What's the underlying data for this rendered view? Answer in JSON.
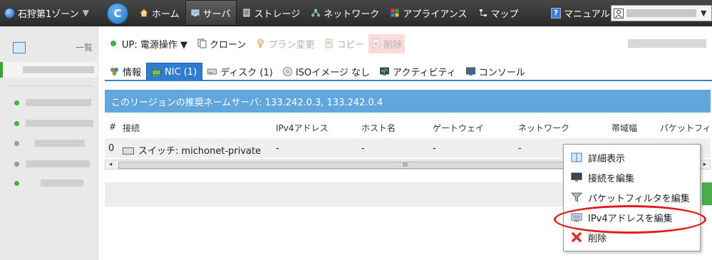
{
  "topbar": {
    "zone_label": "石狩第1ゾーン",
    "zone_caret": "▼",
    "refresh_glyph": "C",
    "nav": [
      {
        "label": "ホーム",
        "icon": "home-icon"
      },
      {
        "label": "サーバ",
        "icon": "monitor-icon",
        "active": true
      },
      {
        "label": "ストレージ",
        "icon": "storage-icon"
      },
      {
        "label": "ネットワーク",
        "icon": "network-icon"
      },
      {
        "label": "アプライアンス",
        "icon": "appliance-icon"
      },
      {
        "label": "マップ",
        "icon": "map-icon"
      }
    ],
    "manual_label": "マニュアル",
    "manual_glyph": "?",
    "user_caret": "▼"
  },
  "sidebar": {
    "list_label": "一覧"
  },
  "actions": {
    "power_label": "UP: 電源操作 ▼",
    "clone_label": "クローン",
    "plan_label": "プラン変更",
    "copy_label": "コピー",
    "delete_label": "削除"
  },
  "tabs": [
    {
      "label": "情報",
      "icon": "info-icon"
    },
    {
      "label": "NIC (1)",
      "icon": "nic-icon",
      "active": true
    },
    {
      "label": "ディスク (1)",
      "icon": "disk-icon"
    },
    {
      "label": "ISOイメージ なし",
      "icon": "cd-icon"
    },
    {
      "label": "アクティビティ",
      "icon": "activity-icon"
    },
    {
      "label": "コンソール",
      "icon": "console-icon"
    }
  ],
  "info_message": "このリージョンの推奨ネームサーバ: 133.242.0.3, 133.242.0.4",
  "table": {
    "headers": [
      "#",
      "接続",
      "IPv4アドレス",
      "ホスト名",
      "ゲートウェイ",
      "ネットワーク",
      "帯域幅",
      "パケットフィ"
    ],
    "rows": [
      [
        "0",
        "スイッチ: michonet-private",
        "-",
        "-",
        "-",
        "-"
      ]
    ],
    "scroll_left": "◂",
    "scroll_grip": "III",
    "scroll_right": "▸"
  },
  "context_menu": [
    {
      "label": "詳細表示",
      "icon": "book-icon"
    },
    {
      "label": "接続を編集",
      "icon": "monitor-icon"
    },
    {
      "label": "パケットフィルタを編集",
      "icon": "filter-icon"
    },
    {
      "label": "IPv4アドレスを編集",
      "icon": "ip-edit-icon",
      "highlighted": true
    },
    {
      "label": "削除",
      "icon": "red-x-icon"
    }
  ],
  "colors": {
    "accent_blue": "#2f7cd0",
    "info_bar": "#61a7de",
    "status_green": "#39b54a",
    "highlight_red": "#e01e1e",
    "topbar": "#333333"
  }
}
